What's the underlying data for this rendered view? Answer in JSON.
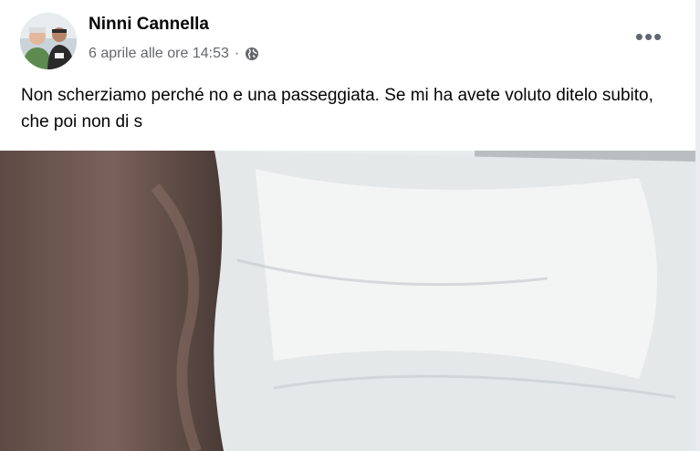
{
  "post": {
    "author": "Ninni Cannella",
    "timestamp": "6 aprile alle ore 14:53",
    "separator": "·",
    "privacy_icon": "globe-icon",
    "more_label": "•••",
    "text": "Non scherziamo perché no e una passeggiata. Se mi ha avete voluto ditelo subito, che poi non di s"
  },
  "colors": {
    "name": "#050505",
    "meta": "#65676b",
    "card": "#ffffff",
    "background": "#e9ebee"
  }
}
